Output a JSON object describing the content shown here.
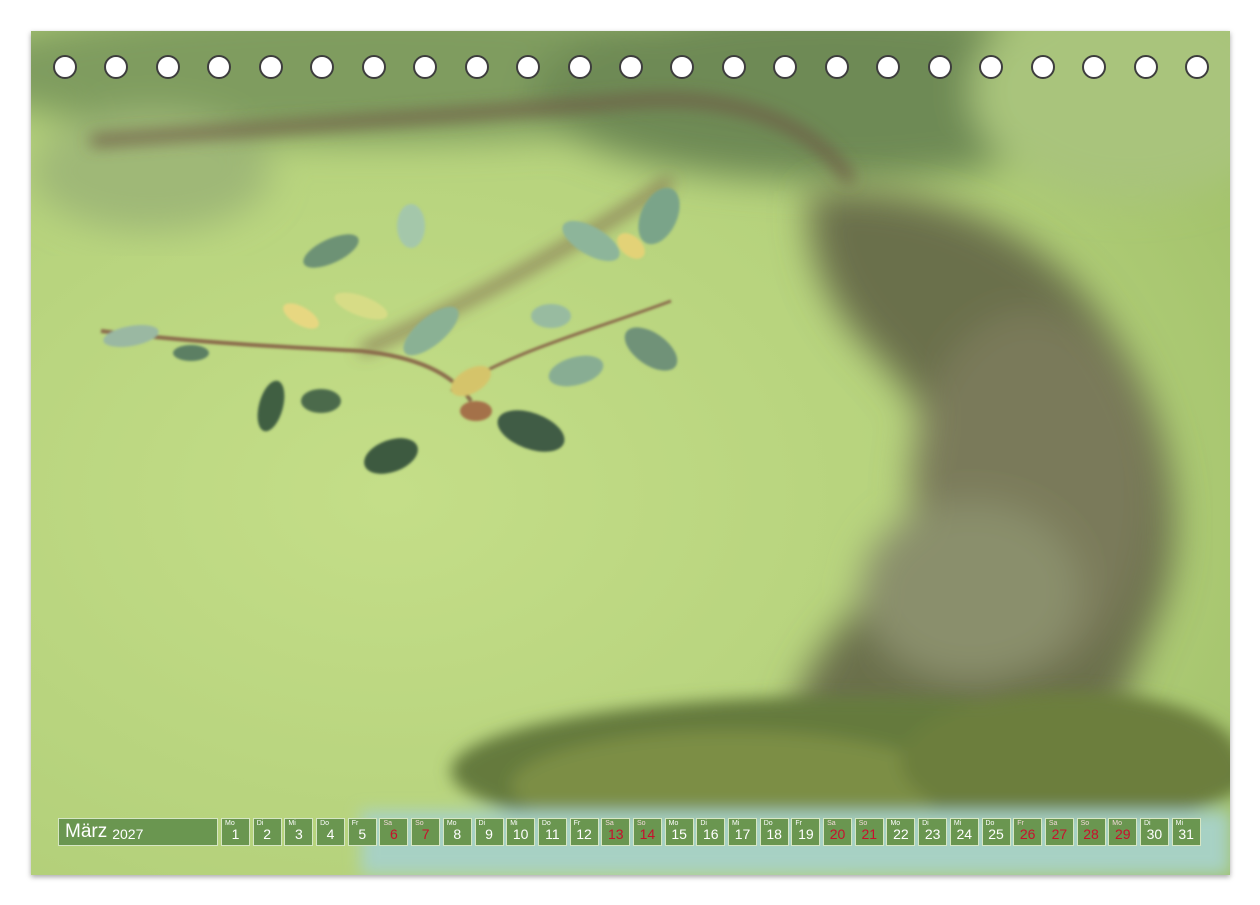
{
  "calendar": {
    "month": "März",
    "year": "2027",
    "days": [
      {
        "wd": "Mo",
        "n": "1",
        "weekend": false
      },
      {
        "wd": "Di",
        "n": "2",
        "weekend": false
      },
      {
        "wd": "Mi",
        "n": "3",
        "weekend": false
      },
      {
        "wd": "Do",
        "n": "4",
        "weekend": false
      },
      {
        "wd": "Fr",
        "n": "5",
        "weekend": false
      },
      {
        "wd": "Sa",
        "n": "6",
        "weekend": true
      },
      {
        "wd": "So",
        "n": "7",
        "weekend": true
      },
      {
        "wd": "Mo",
        "n": "8",
        "weekend": false
      },
      {
        "wd": "Di",
        "n": "9",
        "weekend": false
      },
      {
        "wd": "Mi",
        "n": "10",
        "weekend": false
      },
      {
        "wd": "Do",
        "n": "11",
        "weekend": false
      },
      {
        "wd": "Fr",
        "n": "12",
        "weekend": false
      },
      {
        "wd": "Sa",
        "n": "13",
        "weekend": true
      },
      {
        "wd": "So",
        "n": "14",
        "weekend": true
      },
      {
        "wd": "Mo",
        "n": "15",
        "weekend": false
      },
      {
        "wd": "Di",
        "n": "16",
        "weekend": false
      },
      {
        "wd": "Mi",
        "n": "17",
        "weekend": false
      },
      {
        "wd": "Do",
        "n": "18",
        "weekend": false
      },
      {
        "wd": "Fr",
        "n": "19",
        "weekend": false
      },
      {
        "wd": "Sa",
        "n": "20",
        "weekend": true
      },
      {
        "wd": "So",
        "n": "21",
        "weekend": true
      },
      {
        "wd": "Mo",
        "n": "22",
        "weekend": false
      },
      {
        "wd": "Di",
        "n": "23",
        "weekend": false
      },
      {
        "wd": "Mi",
        "n": "24",
        "weekend": false
      },
      {
        "wd": "Do",
        "n": "25",
        "weekend": false
      },
      {
        "wd": "Fr",
        "n": "26",
        "weekend": true
      },
      {
        "wd": "Sa",
        "n": "27",
        "weekend": true
      },
      {
        "wd": "So",
        "n": "28",
        "weekend": true
      },
      {
        "wd": "Mo",
        "n": "29",
        "weekend": true
      },
      {
        "wd": "Di",
        "n": "30",
        "weekend": false
      },
      {
        "wd": "Mi",
        "n": "31",
        "weekend": false
      }
    ]
  },
  "binding_hole_count": 23,
  "colors": {
    "day_cell": "#6a9650",
    "weekend_text": "#c8102e",
    "background_green": "#b6d27c"
  }
}
